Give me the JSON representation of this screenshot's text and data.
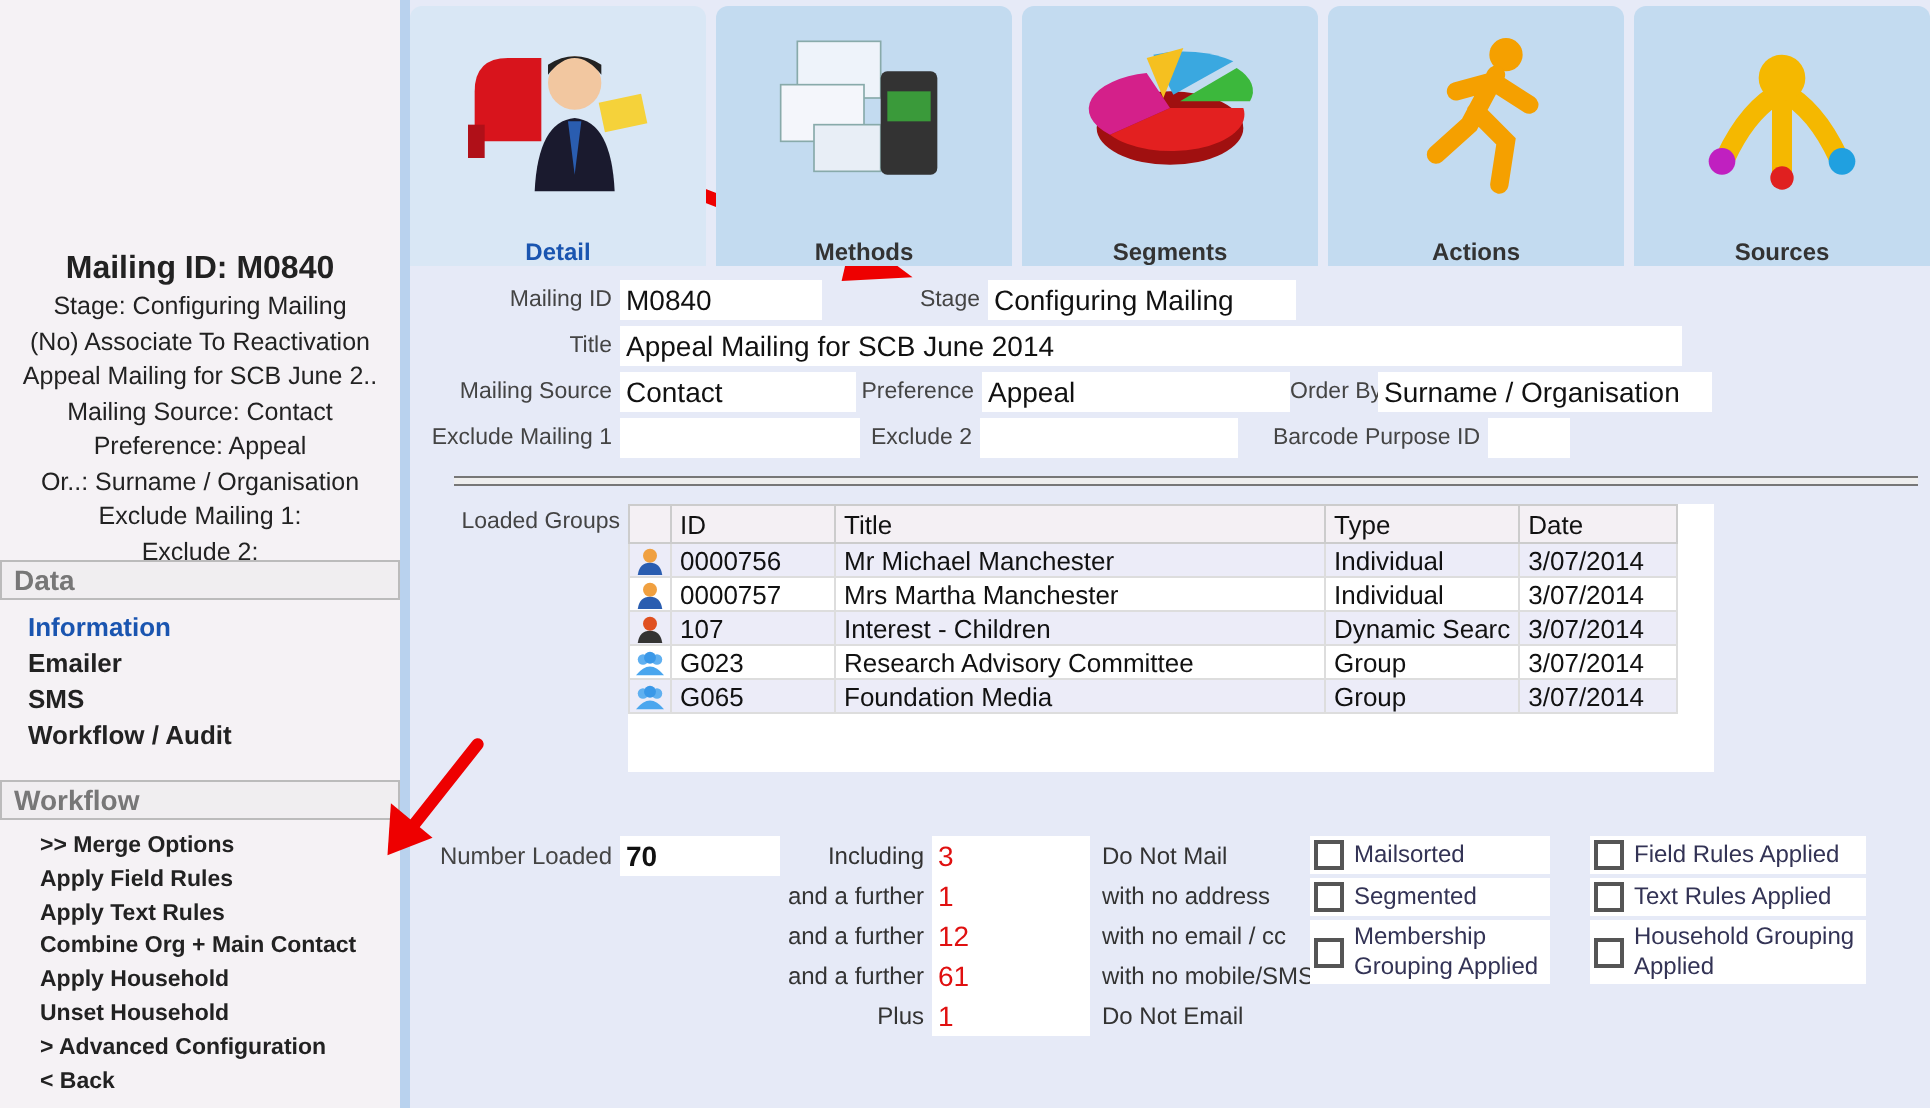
{
  "sidebar": {
    "title": "Mailing ID: M0840",
    "summary": [
      "Stage: Configuring Mailing",
      "(No) Associate To Reactivation",
      "Appeal Mailing for SCB June 2..",
      "Mailing Source: Contact",
      "Preference: Appeal",
      "Or..: Surname / Organisation",
      "Exclude Mailing 1:",
      "Exclude 2:"
    ],
    "sections": [
      {
        "header": "Data",
        "kind": "data",
        "items": [
          {
            "label": "Information",
            "selected": true
          },
          {
            "label": "Emailer",
            "selected": false
          },
          {
            "label": "SMS",
            "selected": false
          },
          {
            "label": "Workflow / Audit",
            "selected": false
          }
        ]
      },
      {
        "header": "Workflow",
        "kind": "actions",
        "items": [
          {
            "label": ">> Merge Options",
            "selected": false
          },
          {
            "label": "Apply Field Rules",
            "selected": false
          },
          {
            "label": "Apply Text Rules",
            "selected": false
          },
          {
            "label": "Combine Org + Main Contact",
            "selected": false
          },
          {
            "label": "Apply Household",
            "selected": false
          },
          {
            "label": "Unset Household",
            "selected": false
          },
          {
            "label": "> Advanced Configuration",
            "selected": false
          },
          {
            "label": "< Back",
            "selected": false
          }
        ]
      }
    ]
  },
  "tabs": [
    {
      "label": "Detail",
      "kind": "mailbox",
      "selected": true
    },
    {
      "label": "Methods",
      "kind": "envelopes",
      "selected": false
    },
    {
      "label": "Segments",
      "kind": "pie",
      "selected": false
    },
    {
      "label": "Actions",
      "kind": "runner",
      "selected": false
    },
    {
      "label": "Sources",
      "kind": "hub",
      "selected": false
    }
  ],
  "form": [
    [
      {
        "label": "Mailing ID",
        "value": "M0840"
      },
      {
        "label": "Stage",
        "value": "Configuring Mailing"
      }
    ],
    [
      {
        "label": "Title",
        "value": "Appeal Mailing for SCB June 2014"
      }
    ],
    [
      {
        "label": "Mailing Source",
        "value": "Contact"
      },
      {
        "label": "Preference",
        "value": "Appeal"
      },
      {
        "label": "Order By",
        "value": "Surname / Organisation"
      }
    ],
    [
      {
        "label": "Exclude Mailing 1"
      },
      {
        "label": "Exclude 2"
      },
      {
        "label": "Barcode Purpose ID"
      }
    ]
  ],
  "loaded_groups": {
    "label": "Loaded Groups",
    "columns": [
      "ID",
      "Title",
      "Type",
      "Date"
    ],
    "rows": [
      {
        "kind": "person",
        "id": "0000756",
        "title": "Mr Michael Manchester",
        "type": "Individual",
        "date": "3/07/2014"
      },
      {
        "kind": "person",
        "id": "0000757",
        "title": "Mrs Martha Manchester",
        "type": "Individual",
        "date": "3/07/2014"
      },
      {
        "kind": "search",
        "id": "107",
        "title": "Interest - Children",
        "type": "Dynamic Searc",
        "date": "3/07/2014"
      },
      {
        "kind": "group",
        "id": "G023",
        "title": "Research Advisory Committee",
        "type": "Group",
        "date": "3/07/2014"
      },
      {
        "kind": "group",
        "id": "G065",
        "title": "Foundation Media",
        "type": "Group",
        "date": "3/07/2014"
      }
    ]
  },
  "number_loaded": {
    "label": "Number Loaded",
    "value": "70"
  },
  "counts": [
    {
      "label": "Including",
      "value": "3",
      "note": "Do Not Mail"
    },
    {
      "label": "and a further",
      "value": "1",
      "note": "with no address"
    },
    {
      "label": "and a further",
      "value": "12",
      "note": "with no email / cc"
    },
    {
      "label": "and a further",
      "value": "61",
      "note": "with no mobile/SMS"
    },
    {
      "label": "Plus",
      "value": "1",
      "note": "Do Not Email"
    }
  ],
  "flags": [
    {
      "label": "Mailsorted",
      "checked": false
    },
    {
      "label": "Field Rules Applied",
      "checked": false
    },
    {
      "label": "Segmented",
      "checked": false
    },
    {
      "label": "Text Rules Applied",
      "checked": false
    },
    {
      "label": "Membership Grouping Applied",
      "checked": false
    },
    {
      "label": "Household Grouping Applied",
      "checked": false
    }
  ]
}
